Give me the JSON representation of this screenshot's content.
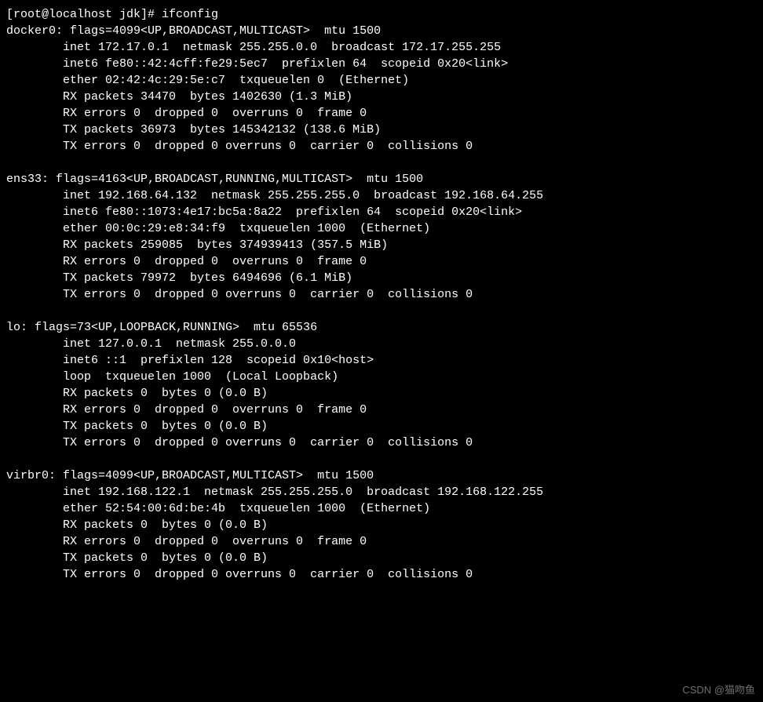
{
  "prompt": "[root@localhost jdk]# ifconfig",
  "interfaces": [
    {
      "name": "docker0",
      "header": "docker0: flags=4099<UP,BROADCAST,MULTICAST>  mtu 1500",
      "lines": [
        "inet 172.17.0.1  netmask 255.255.0.0  broadcast 172.17.255.255",
        "inet6 fe80::42:4cff:fe29:5ec7  prefixlen 64  scopeid 0x20<link>",
        "ether 02:42:4c:29:5e:c7  txqueuelen 0  (Ethernet)",
        "RX packets 34470  bytes 1402630 (1.3 MiB)",
        "RX errors 0  dropped 0  overruns 0  frame 0",
        "TX packets 36973  bytes 145342132 (138.6 MiB)",
        "TX errors 0  dropped 0 overruns 0  carrier 0  collisions 0"
      ]
    },
    {
      "name": "ens33",
      "header": "ens33: flags=4163<UP,BROADCAST,RUNNING,MULTICAST>  mtu 1500",
      "lines": [
        "inet 192.168.64.132  netmask 255.255.255.0  broadcast 192.168.64.255",
        "inet6 fe80::1073:4e17:bc5a:8a22  prefixlen 64  scopeid 0x20<link>",
        "ether 00:0c:29:e8:34:f9  txqueuelen 1000  (Ethernet)",
        "RX packets 259085  bytes 374939413 (357.5 MiB)",
        "RX errors 0  dropped 0  overruns 0  frame 0",
        "TX packets 79972  bytes 6494696 (6.1 MiB)",
        "TX errors 0  dropped 0 overruns 0  carrier 0  collisions 0"
      ]
    },
    {
      "name": "lo",
      "header": "lo: flags=73<UP,LOOPBACK,RUNNING>  mtu 65536",
      "lines": [
        "inet 127.0.0.1  netmask 255.0.0.0",
        "inet6 ::1  prefixlen 128  scopeid 0x10<host>",
        "loop  txqueuelen 1000  (Local Loopback)",
        "RX packets 0  bytes 0 (0.0 B)",
        "RX errors 0  dropped 0  overruns 0  frame 0",
        "TX packets 0  bytes 0 (0.0 B)",
        "TX errors 0  dropped 0 overruns 0  carrier 0  collisions 0"
      ]
    },
    {
      "name": "virbr0",
      "header": "virbr0: flags=4099<UP,BROADCAST,MULTICAST>  mtu 1500",
      "lines": [
        "inet 192.168.122.1  netmask 255.255.255.0  broadcast 192.168.122.255",
        "ether 52:54:00:6d:be:4b  txqueuelen 1000  (Ethernet)",
        "RX packets 0  bytes 0 (0.0 B)",
        "RX errors 0  dropped 0  overruns 0  frame 0",
        "TX packets 0  bytes 0 (0.0 B)",
        "TX errors 0  dropped 0 overruns 0  carrier 0  collisions 0"
      ]
    }
  ],
  "watermark": "CSDN @猫吻鱼"
}
